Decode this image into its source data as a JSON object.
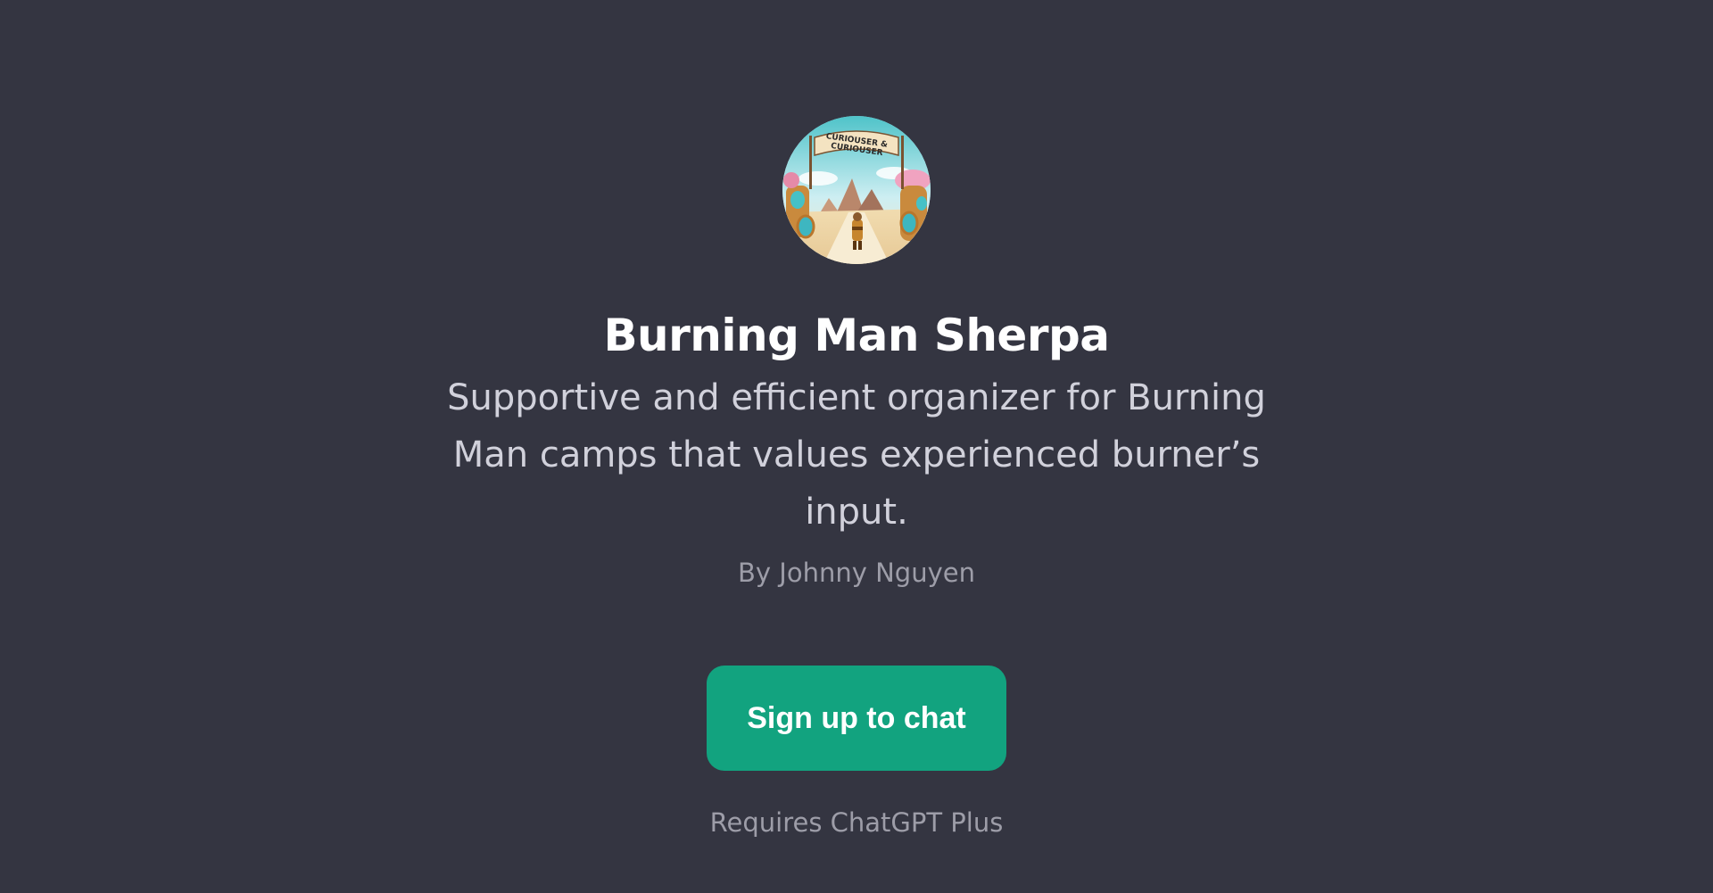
{
  "gpt": {
    "avatar_label": "CURIOUSER & CURIOUSER",
    "name": "Burning Man Sherpa",
    "description": "Supportive and efficient organizer for Burning Man camps that values experienced burner’s input.",
    "author": "By Johnny Nguyen"
  },
  "actions": {
    "signup_label": "Sign up to chat",
    "requirement": "Requires ChatGPT Plus"
  },
  "colors": {
    "background": "#343541",
    "button": "#12a37f",
    "title": "#ffffff",
    "subtitle": "#d1d1db",
    "muted": "#9d9da8"
  }
}
